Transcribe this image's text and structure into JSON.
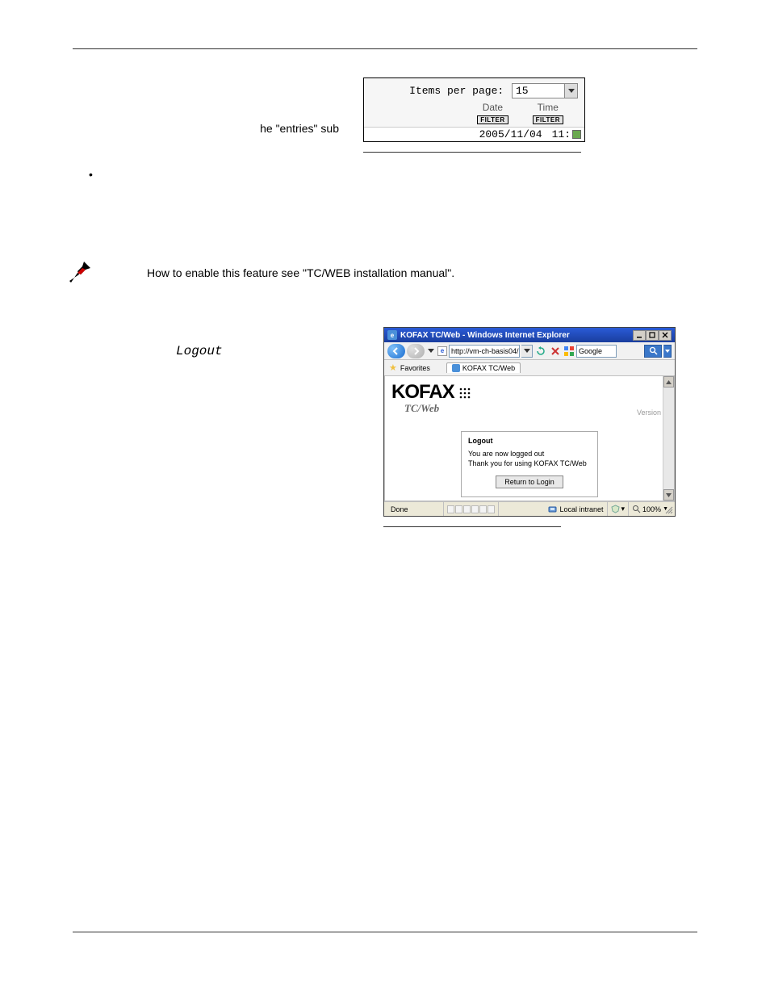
{
  "left_text": "he \"entries\" sub",
  "note_text": "How to enable this feature see \"TC/WEB installation manual\".",
  "logout_label": "Logout",
  "fig1": {
    "items_per_page_label": "Items per page:",
    "items_per_page_value": "15",
    "cols": [
      {
        "label": "Date",
        "filter": "FILTER",
        "value": "2005/11/04"
      },
      {
        "label": "Time",
        "filter": "FILTER",
        "value": "11:"
      }
    ]
  },
  "fig2": {
    "window_title": "KOFAX TC/Web - Windows Internet Explorer",
    "address_url": "http://vm-ch-basis04/",
    "search_provider": "Google",
    "favorites_label": "Favorites",
    "tab_title": "KOFAX TC/Web",
    "logo": "KOFAX",
    "product": "TC/Web",
    "version_label": "Version",
    "logout_heading": "Logout",
    "logout_line1": "You are now logged out",
    "logout_line2": "Thank you for using KOFAX TC/Web",
    "return_button": "Return to Login",
    "status_done": "Done",
    "zone_label": "Local intranet",
    "zoom_value": "100%"
  }
}
